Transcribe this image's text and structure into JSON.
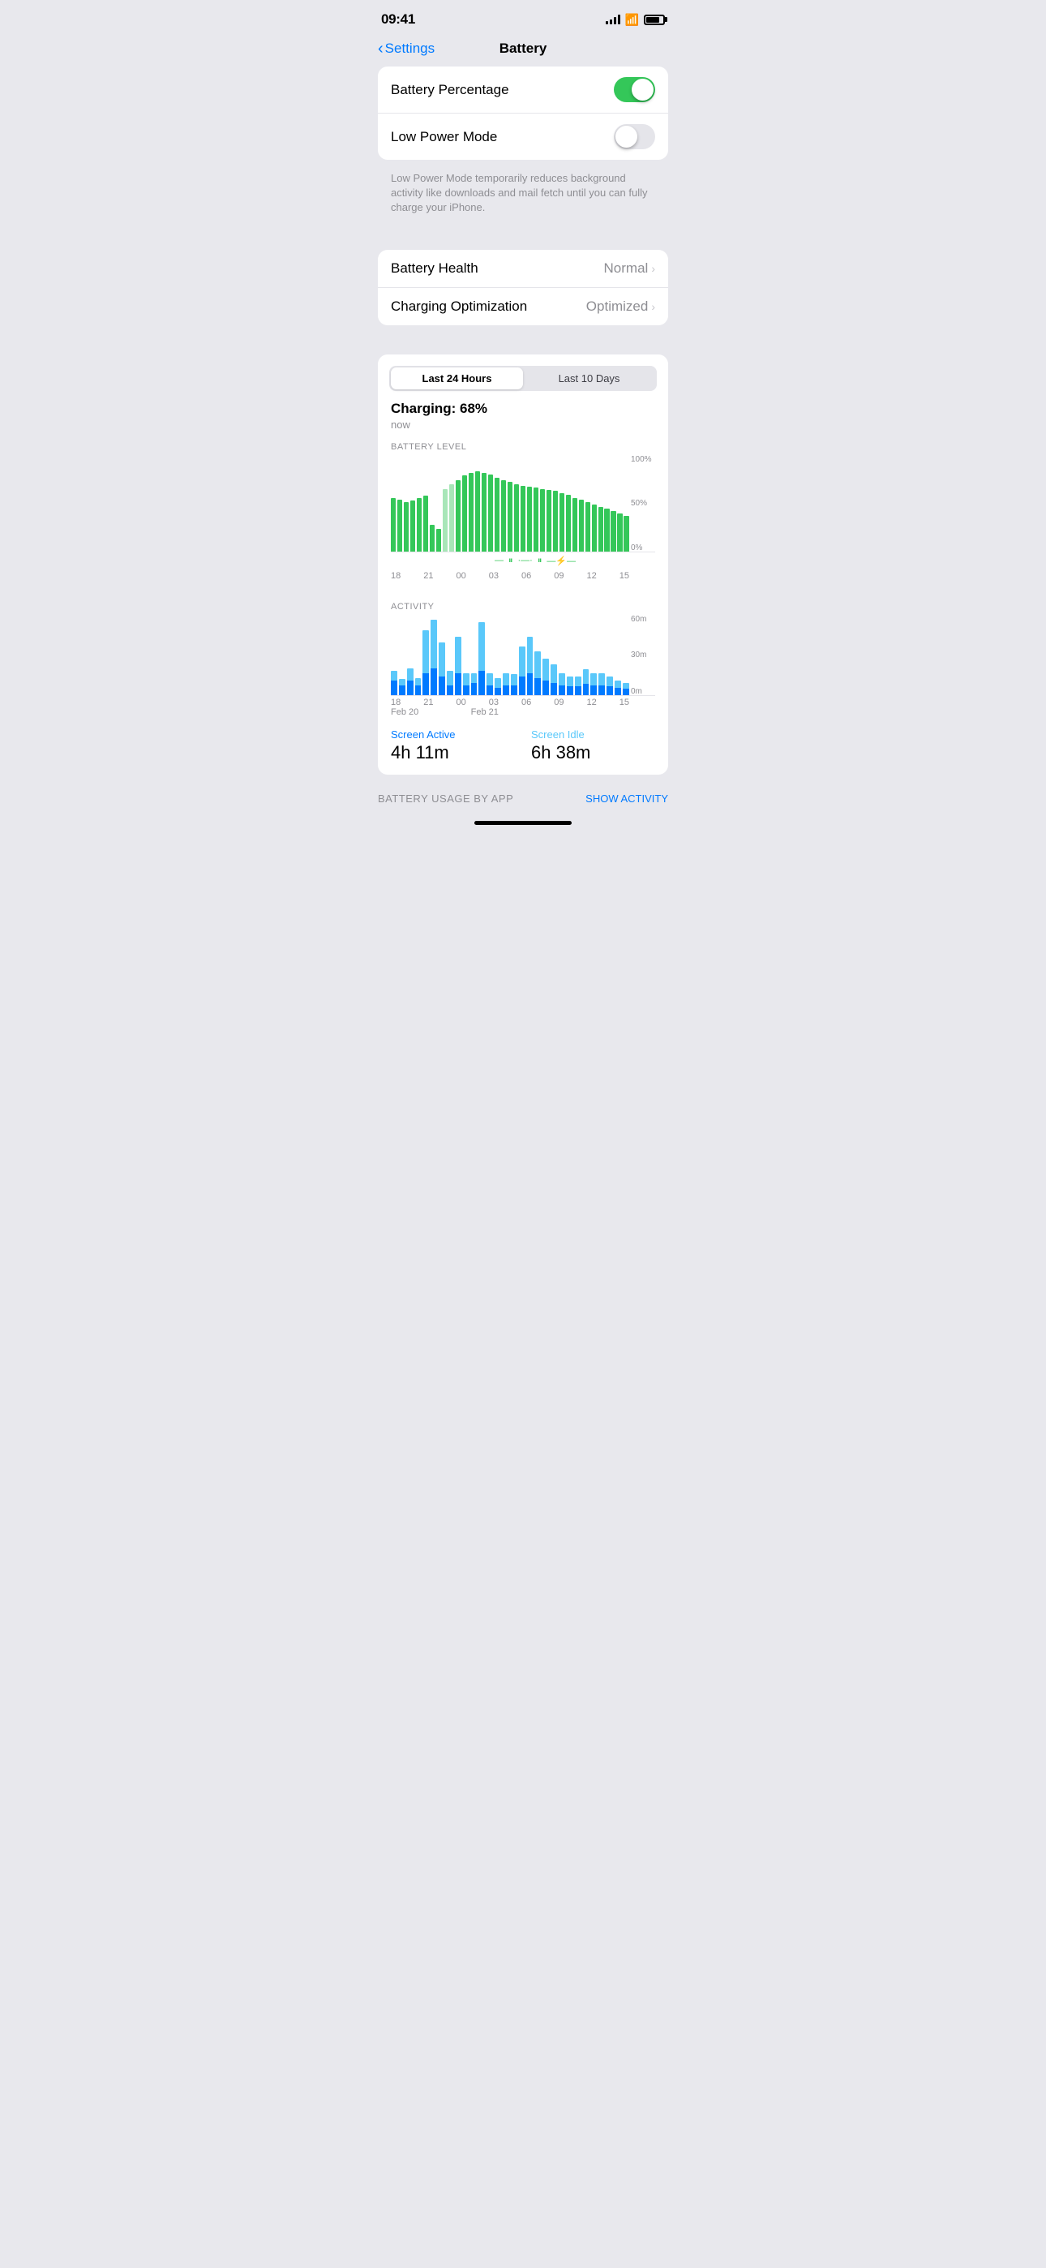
{
  "statusBar": {
    "time": "09:41",
    "batteryLevel": 80
  },
  "nav": {
    "backLabel": "Settings",
    "title": "Battery"
  },
  "settings": {
    "batteryPercentage": {
      "label": "Battery Percentage",
      "enabled": true
    },
    "lowPowerMode": {
      "label": "Low Power Mode",
      "enabled": false,
      "description": "Low Power Mode temporarily reduces background activity like downloads and mail fetch until you can fully charge your iPhone."
    },
    "batteryHealth": {
      "label": "Battery Health",
      "value": "Normal"
    },
    "chargingOptimization": {
      "label": "Charging Optimization",
      "value": "Optimized"
    }
  },
  "chart": {
    "tabs": [
      "Last 24 Hours",
      "Last 10 Days"
    ],
    "activeTab": 0,
    "chargingTitle": "Charging: 68%",
    "chargingSub": "now",
    "batteryChartLabel": "BATTERY LEVEL",
    "activityChartLabel": "ACTIVITY",
    "yLabels": [
      "100%",
      "50%",
      "0%"
    ],
    "activityYLabels": [
      "60m",
      "30m",
      "0m"
    ],
    "xLabels": [
      "18",
      "21",
      "00",
      "03",
      "06",
      "09",
      "12",
      "15"
    ],
    "dateLabels": [
      "Feb 20",
      "",
      "Feb 21",
      "",
      "",
      "",
      "",
      ""
    ],
    "batteryBars": [
      60,
      58,
      55,
      57,
      60,
      62,
      30,
      25,
      70,
      75,
      80,
      85,
      88,
      90,
      88,
      86,
      82,
      80,
      78,
      75,
      73,
      72,
      71,
      70,
      69,
      68,
      65,
      63,
      60,
      58,
      55,
      52,
      50,
      48,
      45,
      42,
      40
    ],
    "chargingBarsLight": [
      false,
      false,
      false,
      false,
      false,
      false,
      false,
      false,
      true,
      true,
      false,
      false,
      false,
      false,
      false,
      false,
      false,
      false,
      false,
      false,
      false,
      false,
      false,
      false,
      false,
      false,
      false,
      false,
      false,
      false,
      false,
      false,
      false,
      false,
      false,
      false,
      false
    ],
    "activityBarsTop": [
      8,
      5,
      10,
      6,
      35,
      40,
      28,
      12,
      30,
      10,
      8,
      40,
      10,
      8,
      10,
      9,
      25,
      30,
      22,
      18,
      15,
      10,
      8,
      8,
      12,
      10,
      10,
      8,
      6,
      5
    ],
    "activityBarsBottom": [
      12,
      8,
      12,
      8,
      18,
      22,
      15,
      8,
      18,
      8,
      10,
      20,
      8,
      6,
      8,
      8,
      15,
      18,
      14,
      12,
      10,
      8,
      7,
      7,
      9,
      8,
      8,
      7,
      6,
      5
    ],
    "screenActive": {
      "label": "Screen Active",
      "value": "4h 11m"
    },
    "screenIdle": {
      "label": "Screen Idle",
      "value": "6h 38m"
    },
    "usageByApp": "BATTERY USAGE BY APP",
    "showActivity": "SHOW ACTIVITY"
  }
}
